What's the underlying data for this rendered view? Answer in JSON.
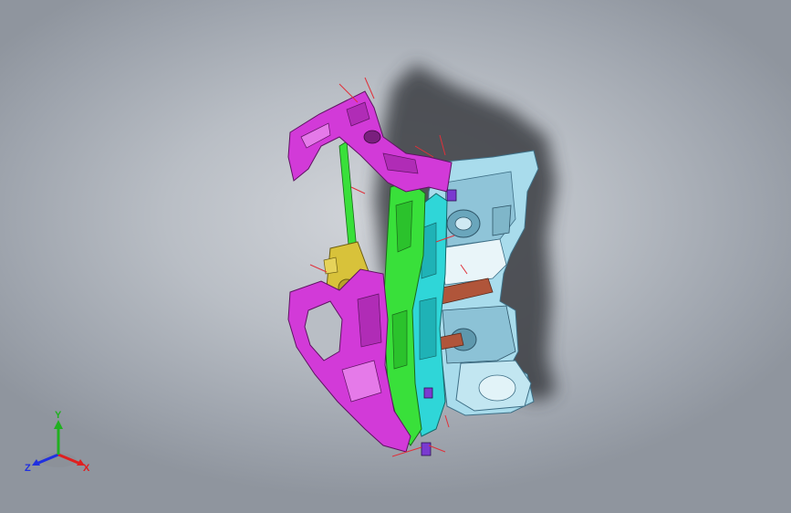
{
  "viewport": {
    "background_top": "#d2d5da",
    "background_bottom": "#8f959e"
  },
  "model": {
    "part_colors": {
      "magenta": "#d23ad8",
      "green": "#39e03a",
      "cyan": "#2fd6d8",
      "light_blue": "#a9dcec",
      "yellow": "#d8c23a",
      "purple": "#7a3ad0",
      "red_lines": "#e0303a",
      "shadow": "#3a3d42"
    }
  },
  "triad": {
    "x_label": "X",
    "y_label": "Y",
    "z_label": "Z",
    "x_color": "#e02020",
    "y_color": "#20b020",
    "z_color": "#2030e0"
  }
}
